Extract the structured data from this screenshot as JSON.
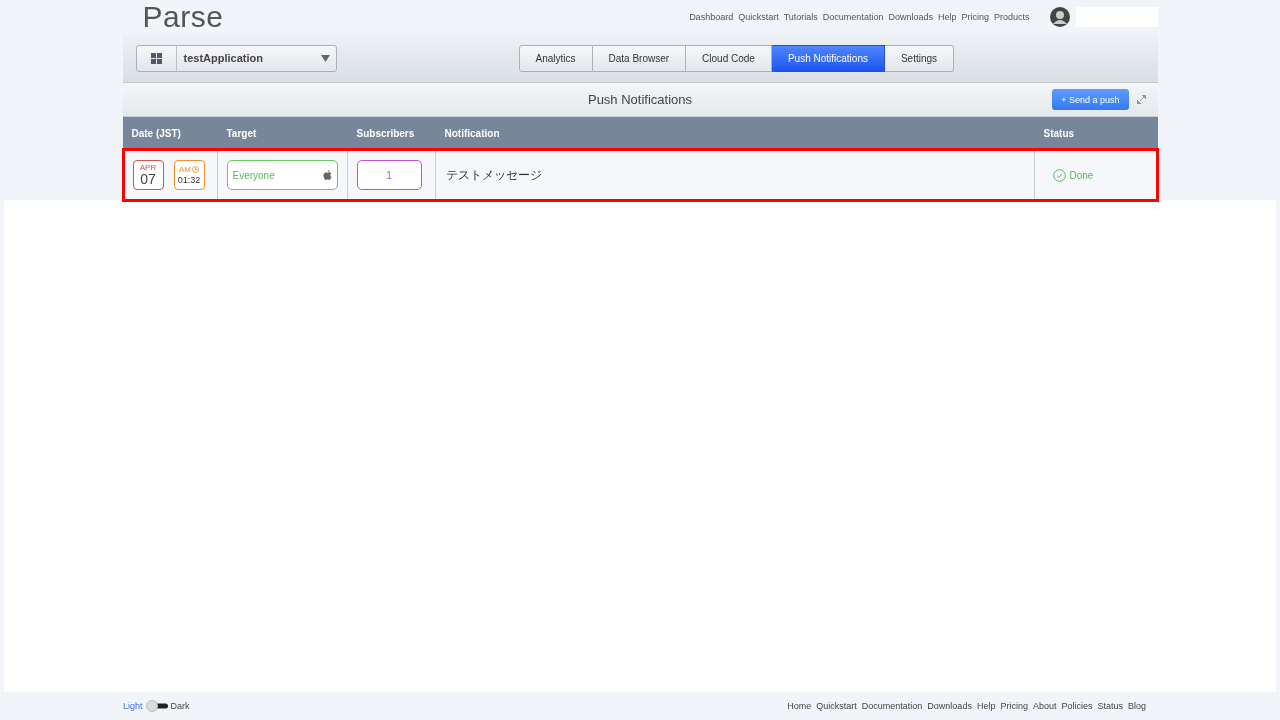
{
  "header": {
    "logo": "Parse",
    "nav_links": [
      "Dashboard",
      "Quickstart",
      "Tutorials",
      "Documentation",
      "Downloads",
      "Help",
      "Pricing",
      "Products"
    ]
  },
  "app_selector": {
    "value": "testApplication"
  },
  "tabs": [
    {
      "label": "Analytics",
      "selected": false
    },
    {
      "label": "Data Browser",
      "selected": false
    },
    {
      "label": "Cloud Code",
      "selected": false
    },
    {
      "label": "Push Notifications",
      "selected": true
    },
    {
      "label": "Settings",
      "selected": false
    }
  ],
  "panel": {
    "title": "Push Notifications",
    "send_button": "+ Send a push"
  },
  "table": {
    "columns": [
      "Date (JST)",
      "Target",
      "Subscribers",
      "Notification",
      "Status"
    ],
    "rows": [
      {
        "month": "APR",
        "day": "07",
        "meridiem": "AM",
        "time": "01:32",
        "target": "Everyone",
        "subscribers": "1",
        "notification": "テストメッセージ",
        "status": "Done",
        "highlighted": true
      }
    ]
  },
  "footer": {
    "themes": [
      {
        "label": "Light",
        "selected": true
      },
      {
        "label": "Dark",
        "selected": false
      }
    ],
    "links": [
      "Home",
      "Quickstart",
      "Documentation",
      "Downloads",
      "Help",
      "Pricing",
      "About",
      "Policies",
      "Status",
      "Blog"
    ]
  }
}
